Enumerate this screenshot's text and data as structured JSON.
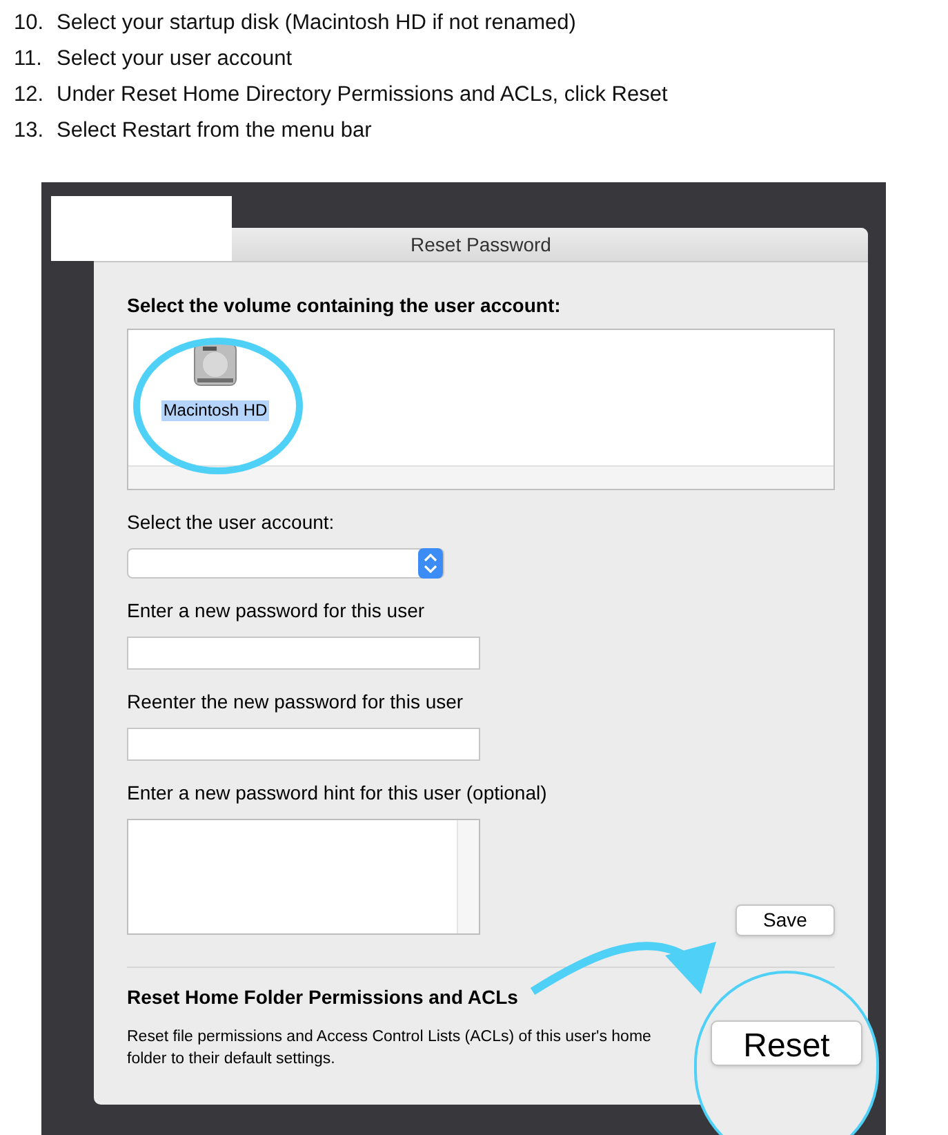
{
  "steps": [
    {
      "number": "10.",
      "text": "Select your startup disk (Macintosh HD if not renamed)"
    },
    {
      "number": "11.",
      "text": "Select your user account"
    },
    {
      "number": "12.",
      "text": "Under Reset Home Directory Permissions and ACLs, click Reset"
    },
    {
      "number": "13.",
      "text": "Select Restart from the menu bar"
    }
  ],
  "dialog": {
    "title": "Reset Password",
    "volume_prompt": "Select the volume containing the user account:",
    "volumes": [
      {
        "label": "Macintosh HD",
        "selected": true
      }
    ],
    "account_label": "Select the user account:",
    "fields": [
      {
        "label": "Enter a new password for this user",
        "kind": "line"
      },
      {
        "label": "Reenter the new password for this user",
        "kind": "line"
      },
      {
        "label": "Enter a new password hint for this user (optional)",
        "kind": "area"
      }
    ],
    "save_button": "Save",
    "section_heading": "Reset Home Folder Permissions and ACLs",
    "section_text": "Reset file permissions and Access Control Lists (ACLs) of this user's home folder to their default settings.",
    "reset_button": "Reset"
  }
}
